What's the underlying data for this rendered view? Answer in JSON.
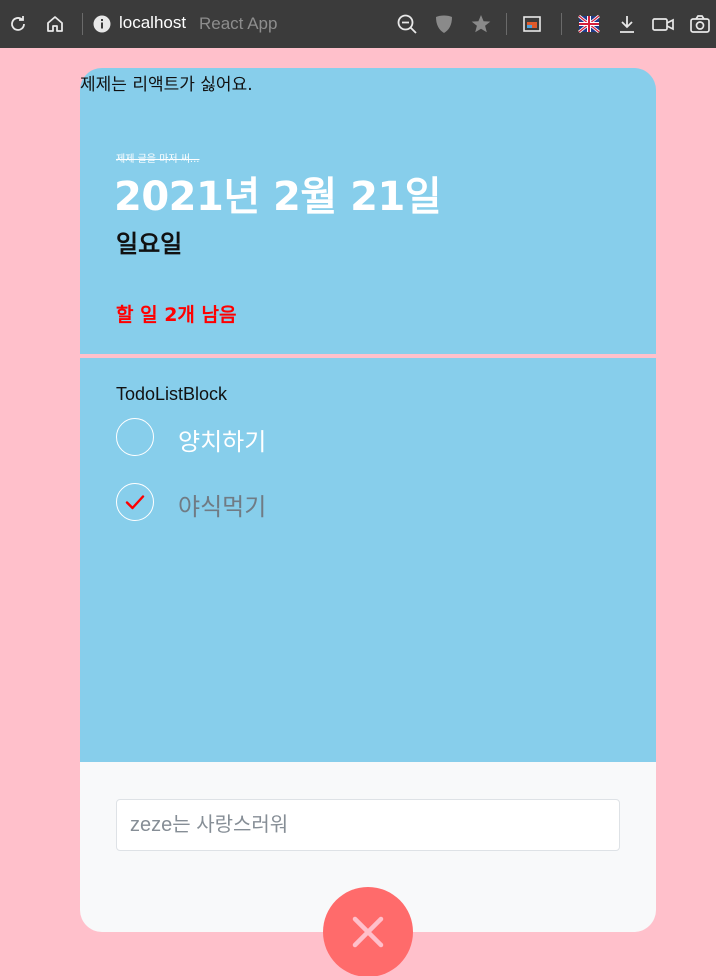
{
  "browser": {
    "host": "localhost",
    "tab_title": "React App"
  },
  "caption": "제제는 리액트가 싫어요.",
  "header": {
    "strike_note": "제제 글을 마저 써...",
    "date": "2021년 2월 21일",
    "day": "일요일",
    "tasks_left": "할 일 2개 남음"
  },
  "list": {
    "label": "TodoListBlock",
    "items": [
      {
        "text": "양치하기",
        "done": false
      },
      {
        "text": "야식먹기",
        "done": true
      }
    ]
  },
  "form": {
    "placeholder": "zeze는 사랑스러워"
  },
  "colors": {
    "page_bg": "#ffc0cb",
    "card_bg": "#87ceeb",
    "tasks_left": "#ff0000",
    "check": "#ff0000",
    "fab": "#ff6b6b"
  }
}
